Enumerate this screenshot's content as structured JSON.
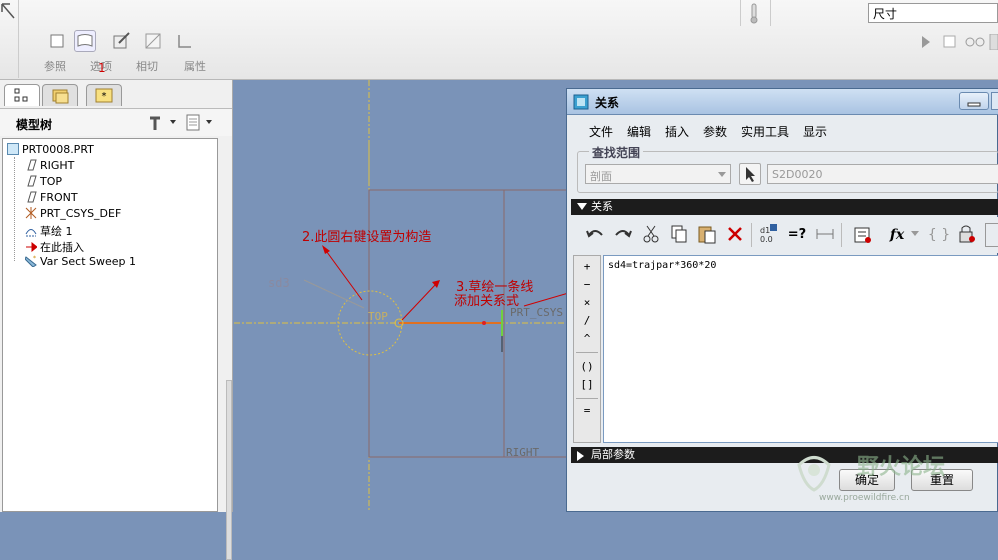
{
  "ribbon": {
    "labels": [
      "参照",
      "选项",
      "相切",
      "属性"
    ],
    "badge": "1",
    "size_select": "尺寸"
  },
  "left_panel": {
    "tree_title": "模型树",
    "tree_items": [
      "PRT0008.PRT",
      "RIGHT",
      "TOP",
      "FRONT",
      "PRT_CSYS_DEF",
      "草绘 1",
      "在此插入",
      "Var Sect Sweep 1"
    ]
  },
  "canvas": {
    "dim_label": "sd3",
    "top_label": "TOP",
    "csys_label": "PRT_CSYS",
    "right_label": "RIGHT",
    "annotation_1": "2.此圆右键设置为构造",
    "annotation_2_line1": "3.草绘一条线",
    "annotation_2_line2": "添加关系式"
  },
  "dialog": {
    "title": "关系",
    "menu": [
      "文件",
      "编辑",
      "插入",
      "参数",
      "实用工具",
      "显示"
    ],
    "scope_label": "查找范围",
    "scope_value": "剖面",
    "scope_target": "S2D0020",
    "relations_header": "关系",
    "relation_text": "sd4=trajpar*360*20",
    "operators": [
      "+",
      "−",
      "×",
      "/",
      "^",
      "()",
      "[]",
      "="
    ],
    "local_params_header": "局部参数",
    "ok_label": "确定",
    "reset_label": "重置",
    "fx_label": "fx",
    "eq_check_label": "=?"
  },
  "watermark": {
    "title": "野火论坛",
    "url": "www.proewildfire.cn"
  },
  "colors": {
    "canvas_bg": "#7a93b8",
    "annotation": "#c00000",
    "datum_yellow": "#e0c040",
    "section_bar": "#1c1c1c"
  }
}
